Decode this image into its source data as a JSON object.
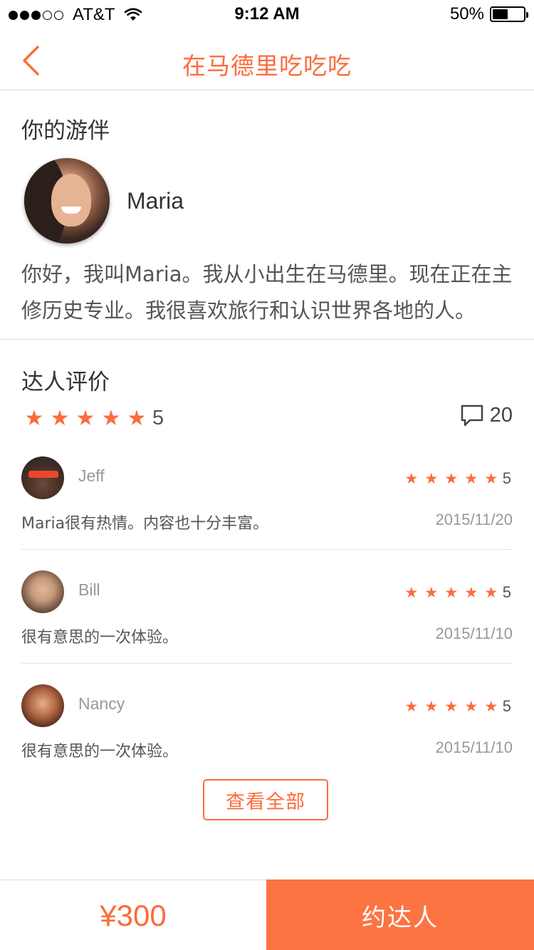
{
  "status_bar": {
    "carrier": "AT&T",
    "time": "9:12 AM",
    "battery_percent": "50%",
    "battery_level": 0.5,
    "signal_bars_filled": 3,
    "signal_bars_total": 5
  },
  "nav": {
    "back_icon": "chevron-left-icon",
    "title": "在马德里吃吃吃"
  },
  "companion": {
    "section_title": "你的游伴",
    "name": "Maria",
    "bio": "你好，我叫Maria。我从小出生在马德里。现在正在主修历史专业。我很喜欢旅行和认识世界各地的人。"
  },
  "reviews": {
    "section_title": "达人评价",
    "rating": "5",
    "rating_stars": 5,
    "comment_icon": "comment-icon",
    "comment_count": "20",
    "items": [
      {
        "name": "Jeff",
        "rating": "5",
        "text": "Maria很有热情。内容也十分丰富。",
        "date": "2015/11/20"
      },
      {
        "name": "Bill",
        "rating": "5",
        "text": "很有意思的一次体验。",
        "date": "2015/11/10"
      },
      {
        "name": "Nancy",
        "rating": "5",
        "text": "很有意思的一次体验。",
        "date": "2015/11/10"
      }
    ],
    "view_all_label": "查看全部"
  },
  "footer": {
    "price": "¥300",
    "book_label": "约达人"
  },
  "colors": {
    "accent": "#fc6c3c",
    "button_bg": "#fd7443",
    "divider": "#dcdcdc",
    "text_primary": "#333333",
    "text_secondary": "#999999"
  }
}
